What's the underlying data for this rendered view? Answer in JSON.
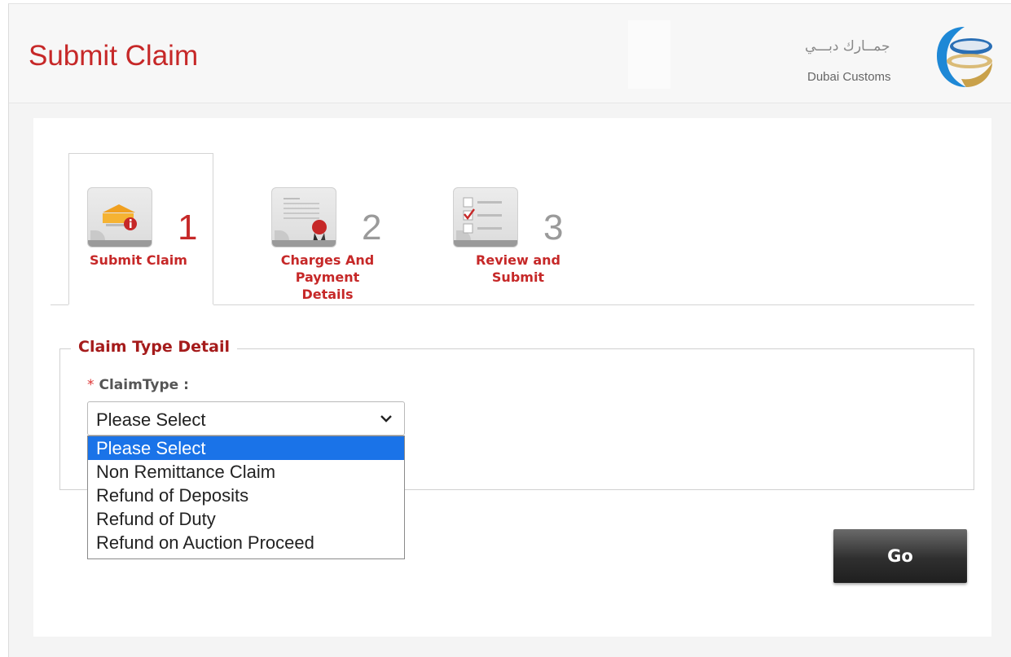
{
  "page": {
    "title": "Submit Claim"
  },
  "logo": {
    "arabic": "جمــارك دبـــي",
    "english": "Dubai Customs",
    "icon": "dubai-customs-logo-icon"
  },
  "wizard": {
    "steps": [
      {
        "number": "1",
        "label_line1": "Submit Claim",
        "label_line2": "",
        "label_line3": "",
        "active": true,
        "icon": "claim-folder-icon"
      },
      {
        "number": "2",
        "label_line1": "Charges And",
        "label_line2": "Payment",
        "label_line3": "Details",
        "active": false,
        "icon": "certificate-icon"
      },
      {
        "number": "3",
        "label_line1": "Review and",
        "label_line2": "Submit",
        "label_line3": "",
        "active": false,
        "icon": "checklist-icon"
      }
    ]
  },
  "claim_detail": {
    "legend": "Claim Type Detail",
    "required_marker": "*",
    "field_label": "ClaimType :",
    "selected_value": "Please Select",
    "options": [
      "Please Select",
      "Non Remittance Claim",
      "Refund of Deposits",
      "Refund of Duty",
      "Refund on Auction Proceed"
    ],
    "highlighted_index": 0
  },
  "actions": {
    "go_label": "Go"
  },
  "colors": {
    "title_red": "#c62828",
    "legend_red": "#a51b1b",
    "selected_option_blue": "#1a73e8",
    "active_step_number": "#c62828",
    "inactive_step_number": "#9a9a9a"
  }
}
